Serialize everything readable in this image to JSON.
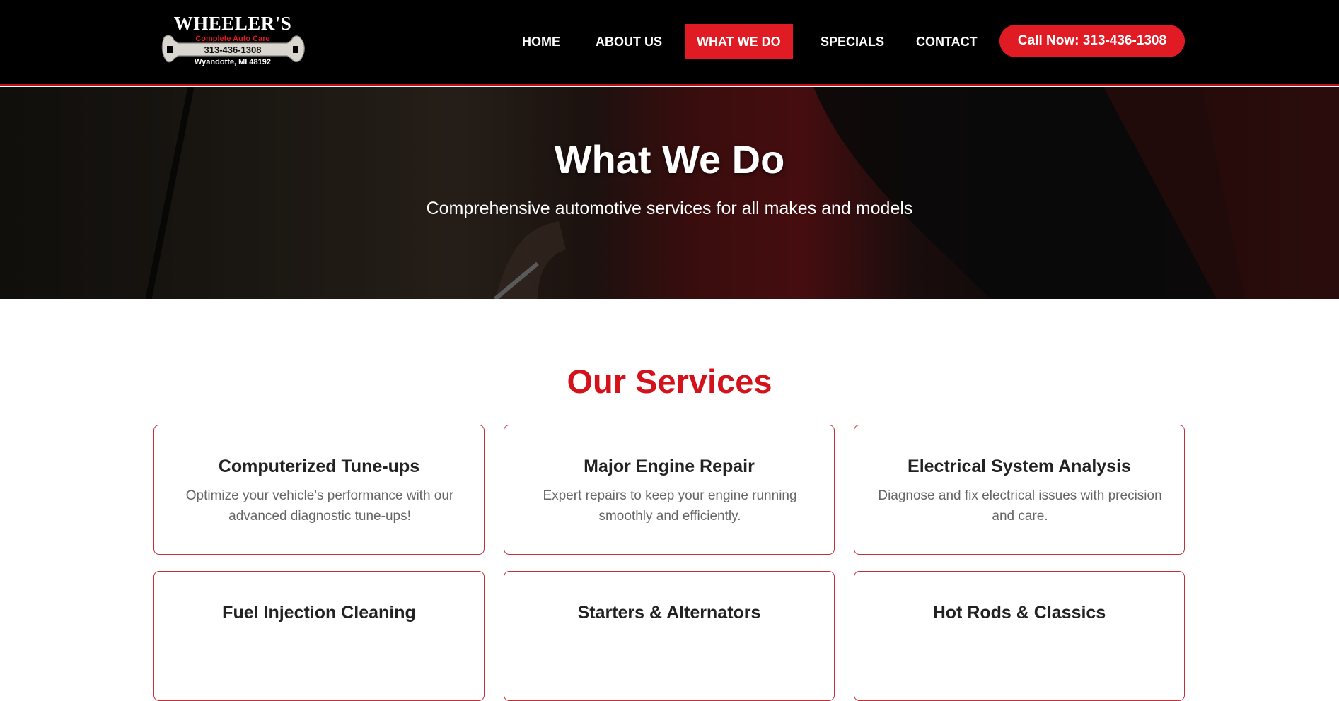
{
  "logo": {
    "name": "WHEELER'S",
    "tagline": "Complete Auto Care",
    "phone": "313-436-1308",
    "address": "Wyandotte, MI 48192"
  },
  "nav": {
    "items": [
      {
        "label": "HOME",
        "active": false
      },
      {
        "label": "ABOUT US",
        "active": false
      },
      {
        "label": "WHAT WE DO",
        "active": true
      },
      {
        "label": "SPECIALS",
        "active": false
      },
      {
        "label": "CONTACT",
        "active": false
      }
    ],
    "call_label": "Call Now: 313-436-1308"
  },
  "hero": {
    "title": "What We Do",
    "subtitle": "Comprehensive automotive services for all makes and models"
  },
  "services": {
    "title": "Our Services",
    "items": [
      {
        "title": "Computerized Tune-ups",
        "description": "Optimize your vehicle's performance with our advanced diagnostic tune-ups!"
      },
      {
        "title": "Major Engine Repair",
        "description": "Expert repairs to keep your engine running smoothly and efficiently."
      },
      {
        "title": "Electrical System Analysis",
        "description": "Diagnose and fix electrical issues with precision and care."
      },
      {
        "title": "Fuel Injection Cleaning",
        "description": ""
      },
      {
        "title": "Starters & Alternators",
        "description": ""
      },
      {
        "title": "Hot Rods & Classics",
        "description": ""
      }
    ]
  },
  "colors": {
    "accent": "#e01b24",
    "header_bg": "#000000",
    "services_title": "#d4121c",
    "card_border": "#c0303a"
  }
}
